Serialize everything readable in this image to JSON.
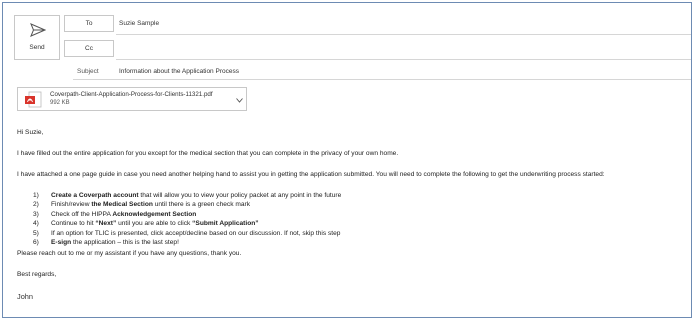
{
  "compose": {
    "send_label": "Send",
    "to_label": "To",
    "to_value": "Suzie Sample",
    "cc_label": "Cc",
    "cc_value": "",
    "subject_label": "Subject",
    "subject_value": "Information about the Application Process"
  },
  "attachment": {
    "name": "Coverpath-Client-Application-Process-for-Clients-11321.pdf",
    "size": "992 KB",
    "icon": "pdf-icon"
  },
  "message": {
    "greeting": "Hi Suzie,",
    "para1": "I have filled out the entire application for you except for the medical section that you can complete in the privacy of your own home.",
    "para2": "I have attached a one page guide in case you need another helping hand to assist you in getting the application submitted. You will need to complete the following to get the underwriting process started:",
    "steps": [
      {
        "num": "1)",
        "pre": "",
        "bold": "Create a Coverpath account",
        "post": " that will allow you to view your policy packet at any point in the future"
      },
      {
        "num": "2)",
        "pre": "Finish/review ",
        "bold": "the Medical Section",
        "post": " until there is a green check mark"
      },
      {
        "num": "3)",
        "pre": "Check off the HIPPA ",
        "bold": "Acknowledgement Section",
        "post": ""
      },
      {
        "num": "4)",
        "pre": "Continue to hit ",
        "bold": "“Next”",
        "post": " until you are able to click ",
        "bold2": "“Submit Application”"
      },
      {
        "num": "5)",
        "pre": "If an option for TLIC is presented, click accept/decline based on our discussion. If not, skip this step",
        "bold": "",
        "post": ""
      },
      {
        "num": "6)",
        "pre": "",
        "bold": "E-sign",
        "post": " the application – this is the last step!"
      }
    ],
    "closing1": "Please reach out to me or my assistant if you have any questions, thank you.",
    "closing2": "Best regards,",
    "signature": "John"
  },
  "colors": {
    "frame_border": "#6d8bb3",
    "pdf_red": "#d9342b"
  }
}
